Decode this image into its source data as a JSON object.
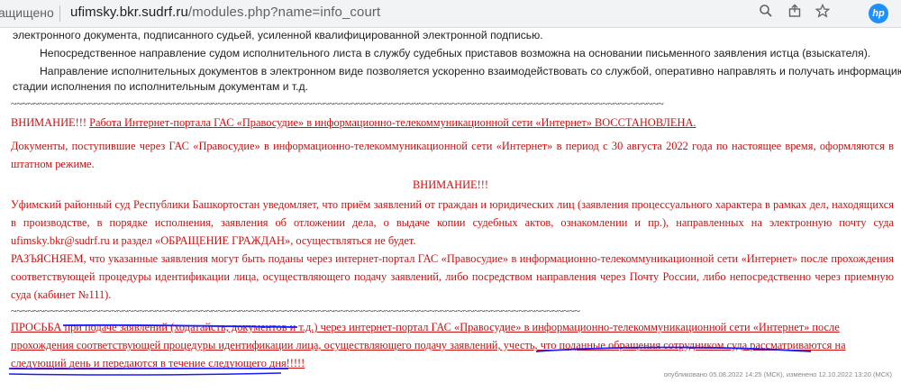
{
  "browser": {
    "security_text": "ащищено",
    "domain": "ufimsky.bkr.sudrf.ru",
    "path": "/modules.php?name=info_court",
    "icons": [
      "search-icon",
      "share-icon",
      "star-icon",
      "hp-extension-icon"
    ],
    "hp_label": "hp"
  },
  "content": {
    "p1": "электронного документа, подписанного судьей, усиленной квалифицированной электронной подписью.",
    "p2": "Непосредственное направление судом исполнительного листа в службу судебных приставов возможна на основании письменного заявления истца (взыскателя).",
    "p3_a": "Направление исполнительных документов в электронном виде позволяется ускоренно взаимодействовать со службой, оперативно направлять и получать информацию о",
    "p3_b": "стадии исполнения по исполнительным документам и т.д.",
    "tilde1": "~~~~~~~~~~~~~~~~~~~~~~~~~~~~~~~~~~~~~~~~~~~~~~~~~~~~~~~~~~~~~~~~~~~~~~~~~~~~~~~~~~~~~~~~~~~~~~~~~~~~~~~~~~~~~~~~~~~~~",
    "warn1_prefix": "ВНИМАНИЕ!!! ",
    "warn1_underlined": "Работа Интернет-портала ГАС «Правосудие» в информационно-телекоммуникационной сети «Интернет» ВОССТАНОВЛЕНА.",
    "docs_text": "Документы, поступившие через ГАС «Правосудие» в информационно-телекоммуникационной сети «Интернет» в период с 30 августа 2022 года по настоящее время, оформляются в штатном режиме.",
    "warn2": "ВНИМАНИЕ!!!",
    "notice_text": "Уфимский районный суд Республики Башкортостан уведомляет, что приём заявлений от граждан и юридических лиц (заявления процессуального характера в рамках дел, находящихся в производстве, в порядке исполнения, заявления об отложении дела, о выдаче копии судебных актов, ознакомлении и пр.), направленных на электронную почту суда ufimsky.bkr@sudrf.ru и раздел «ОБРАЩЕНИЕ ГРАЖДАН», осуществляться не будет.",
    "explain_text": "РАЗЪЯСНЯЕМ, что указанные заявления могут быть поданы через интернет-портал ГАС «Правосудие» в информационно-телекоммуникационной сети «Интернет» после прохождения соответствующей процедуры идентификации лица, осуществляющего подачу заявлений, либо посредством направления через Почту России, либо непосредственно через приемную суда (кабинет №111).",
    "tilde2": "~~~~~~~~~~~~~~~~~~~~~~~~~~~~~~~~~~~~~~~~~~~~~~~~~~~~~~~~~~~~~~~~~~~~~~~~~~~~~~~~~~~~~~~~~~~~~~~~~~~~~~",
    "request_text": "ПРОСЬБА при подаче заявлений (ходатайств, документов и т.д.) через интернет-портал ГАС «Правосудие» в информационно-телекоммуникационной сети «Интернет» после прохождения соответствующей процедуры идентификации лица, осуществляющего подачу заявлений, учесть, что поданные обращения сотрудником суда рассматриваются на следующий день и передаются в течение следующего дня!!!!!",
    "footer_text": "опубликовано 05.08.2022 14:25 (МСК), изменено 12.10.2022 13:20 (МСК)"
  },
  "colors": {
    "red_text": "#cc1111",
    "marker_blue": "#1a1aff"
  }
}
